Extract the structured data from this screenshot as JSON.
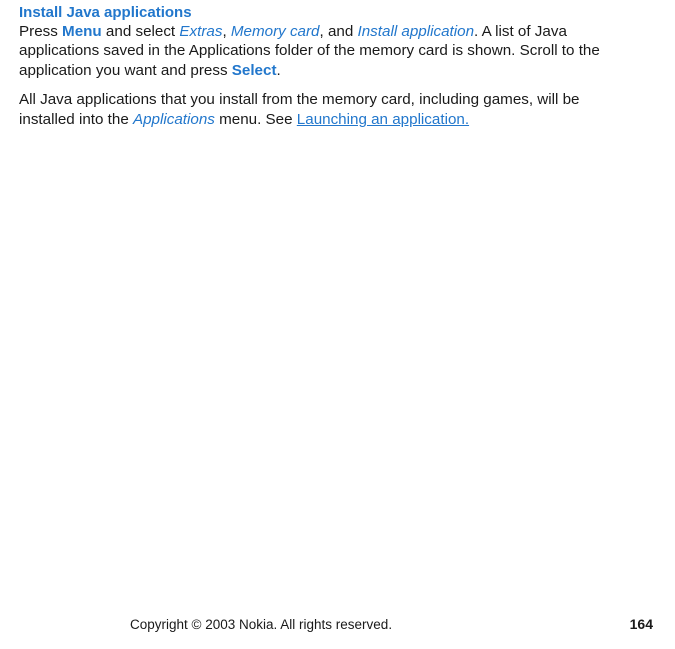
{
  "heading": "Install Java applications",
  "p1": {
    "t1": "Press ",
    "menu": "Menu",
    "t2": " and select ",
    "extras": "Extras",
    "t3": ", ",
    "memcard": "Memory card",
    "t4": ", and ",
    "install": "Install application",
    "t5": ". A list of Java applications saved in the Applications folder of the memory card is shown. Scroll to the application you want and press ",
    "select": "Select",
    "t6": "."
  },
  "p2": {
    "t1": "All Java applications that you install from the memory card, including games, will be installed into the ",
    "apps": "Applications",
    "t2": " menu. See ",
    "link": "Launching an application."
  },
  "footer": {
    "copyright": "Copyright © 2003 Nokia. All rights reserved.",
    "page": "164"
  }
}
